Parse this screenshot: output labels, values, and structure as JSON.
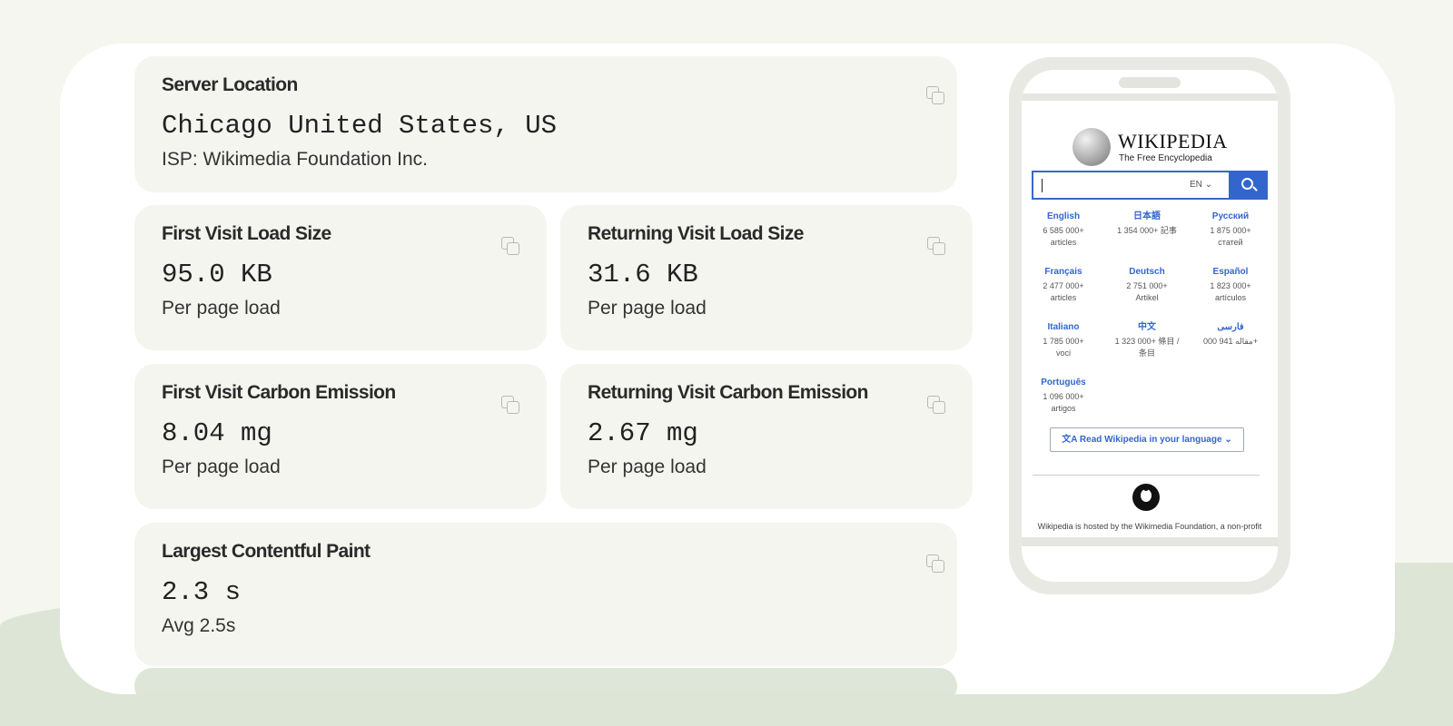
{
  "metrics": {
    "server_location": {
      "label": "Server Location",
      "value": "Chicago United States, US",
      "sub": "ISP: Wikimedia Foundation Inc."
    },
    "first_visit_load": {
      "label": "First Visit Load Size",
      "value": "95.0 KB",
      "sub": "Per page load"
    },
    "returning_visit_load": {
      "label": "Returning Visit Load Size",
      "value": "31.6 KB",
      "sub": "Per page load"
    },
    "first_visit_carbon": {
      "label": "First Visit Carbon Emission",
      "value": "8.04 mg",
      "sub": "Per page load"
    },
    "returning_visit_carbon": {
      "label": "Returning Visit Carbon Emission",
      "value": "2.67 mg",
      "sub": "Per page load"
    },
    "lcp": {
      "label": "Largest Contentful Paint",
      "value": "2.3 s",
      "sub": "Avg 2.5s"
    }
  },
  "preview": {
    "logo_title": "WIKIPEDIA",
    "tagline": "The Free Encyclopedia",
    "search_lang": "EN",
    "languages": [
      {
        "name": "English",
        "count": "6 585 000+",
        "unit": "articles"
      },
      {
        "name": "日本語",
        "count": "1 354 000+ 記事",
        "unit": ""
      },
      {
        "name": "Русский",
        "count": "1 875 000+",
        "unit": "статей"
      },
      {
        "name": "Français",
        "count": "2 477 000+",
        "unit": "articles"
      },
      {
        "name": "Deutsch",
        "count": "2 751 000+",
        "unit": "Artikel"
      },
      {
        "name": "Español",
        "count": "1 823 000+",
        "unit": "artículos"
      },
      {
        "name": "Italiano",
        "count": "1 785 000+",
        "unit": "voci"
      },
      {
        "name": "中文",
        "count": "1 323 000+ 條目 /",
        "unit": "条目"
      },
      {
        "name": "فارسی",
        "count": "مقاله 941 000+",
        "unit": ""
      },
      {
        "name": "Português",
        "count": "1 096 000+",
        "unit": "artigos"
      }
    ],
    "read_button": "Read Wikipedia in your language",
    "footer": "Wikipedia is hosted by the Wikimedia Foundation, a non-profit"
  },
  "colors": {
    "page_bg": "#f5f6f0",
    "panel_bg": "#ffffff",
    "card_bg": "#f5f5f0",
    "wiki_blue": "#3366cc"
  },
  "icons": [
    "copy-icon",
    "search-icon",
    "translate-icon",
    "chevron-down-icon",
    "wikimedia-logo"
  ]
}
